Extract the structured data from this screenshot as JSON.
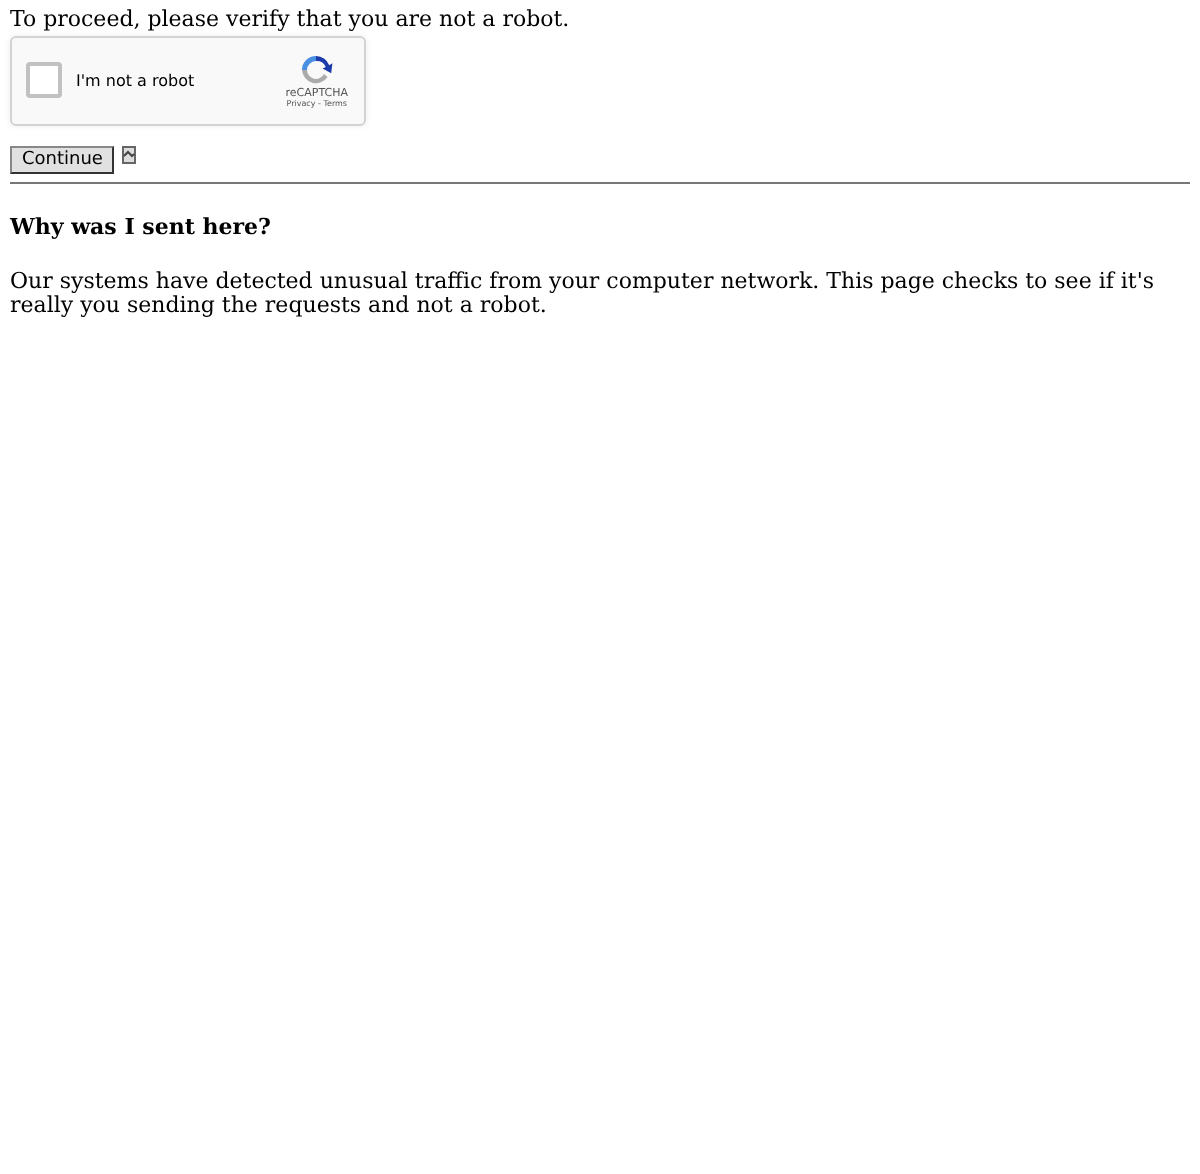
{
  "prompt": "To proceed, please verify that you are not a robot.",
  "captcha": {
    "label": "I'm not a robot",
    "checked": false,
    "brand": "reCAPTCHA",
    "links": "Privacy - Terms"
  },
  "submit_button": "Continue",
  "heading": "Why was I sent here?",
  "explanation": "Our systems have detected unusual traffic from your computer network. This page checks to see if it's really you sending the requests and not a robot."
}
